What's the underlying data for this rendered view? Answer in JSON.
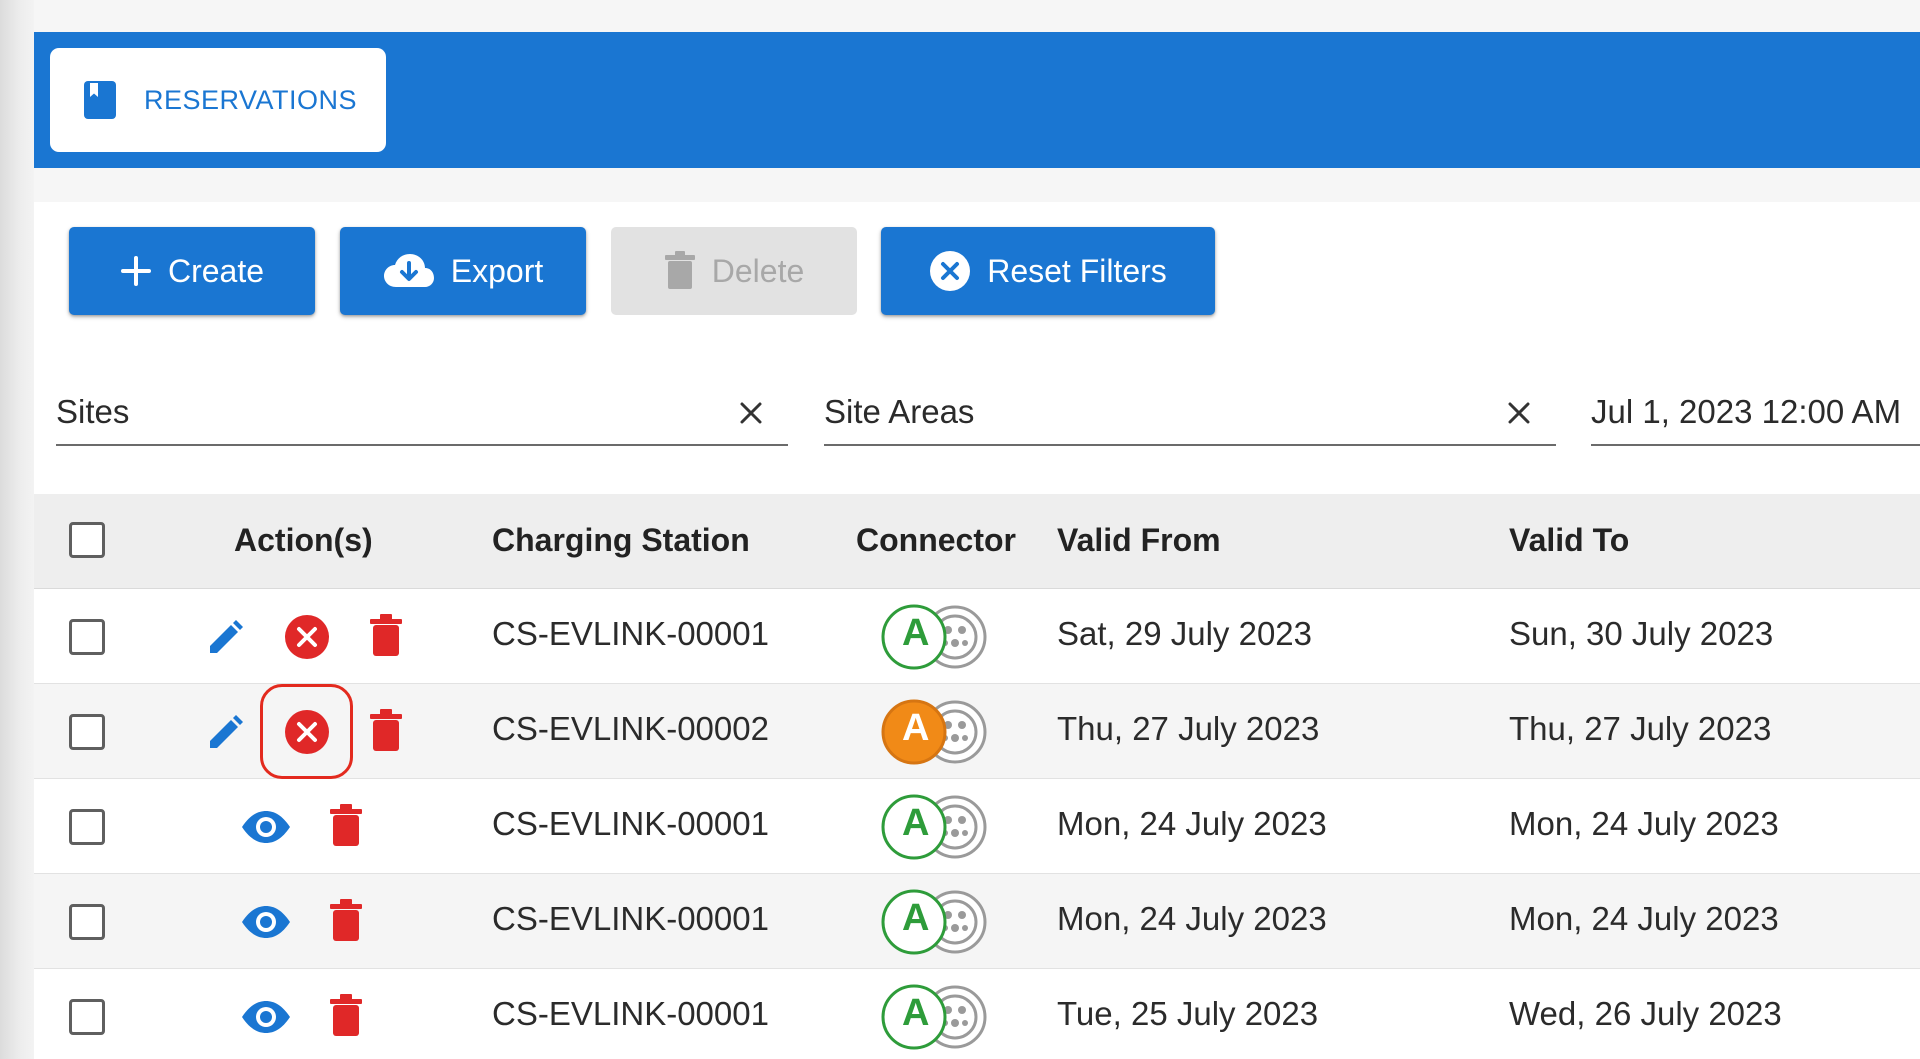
{
  "header": {
    "tab_label": "RESERVATIONS",
    "tab_icon": "bookmark-book-icon",
    "accent_color": "#1a76d2"
  },
  "toolbar": {
    "create_label": "Create",
    "export_label": "Export",
    "delete_label": "Delete",
    "delete_disabled": true,
    "reset_label": "Reset Filters"
  },
  "filters": {
    "sites": "Sites",
    "site_areas": "Site Areas",
    "date_from": "Jul 1, 2023 12:00 AM"
  },
  "table": {
    "columns": {
      "actions": "Action(s)",
      "charging_station": "Charging Station",
      "connector": "Connector",
      "valid_from": "Valid From",
      "valid_to": "Valid To"
    },
    "rows": [
      {
        "actions": [
          "edit",
          "cancel",
          "delete"
        ],
        "charging_station": "CS-EVLINK-00001",
        "connector": "A",
        "connector_status": "available",
        "valid_from": "Sat, 29 July 2023",
        "valid_to": "Sun, 30 July 2023"
      },
      {
        "actions": [
          "edit",
          "cancel",
          "delete"
        ],
        "charging_station": "CS-EVLINK-00002",
        "connector": "A",
        "connector_status": "occupied",
        "valid_from": "Thu, 27 July 2023",
        "valid_to": "Thu, 27 July 2023",
        "highlighted_action": "cancel"
      },
      {
        "actions": [
          "view",
          "delete"
        ],
        "charging_station": "CS-EVLINK-00001",
        "connector": "A",
        "connector_status": "available",
        "valid_from": "Mon, 24 July 2023",
        "valid_to": "Mon, 24 July 2023"
      },
      {
        "actions": [
          "view",
          "delete"
        ],
        "charging_station": "CS-EVLINK-00001",
        "connector": "A",
        "connector_status": "available",
        "valid_from": "Mon, 24 July 2023",
        "valid_to": "Mon, 24 July 2023"
      },
      {
        "actions": [
          "view",
          "delete"
        ],
        "charging_station": "CS-EVLINK-00001",
        "connector": "A",
        "connector_status": "available",
        "valid_from": "Tue, 25 July 2023",
        "valid_to": "Wed, 26 July 2023"
      }
    ]
  },
  "colors": {
    "primary": "#1a76d2",
    "danger": "#e02828",
    "connector_available": "#2e9c3a",
    "connector_occupied": "#f18a17",
    "highlight": "#e32a1e"
  }
}
